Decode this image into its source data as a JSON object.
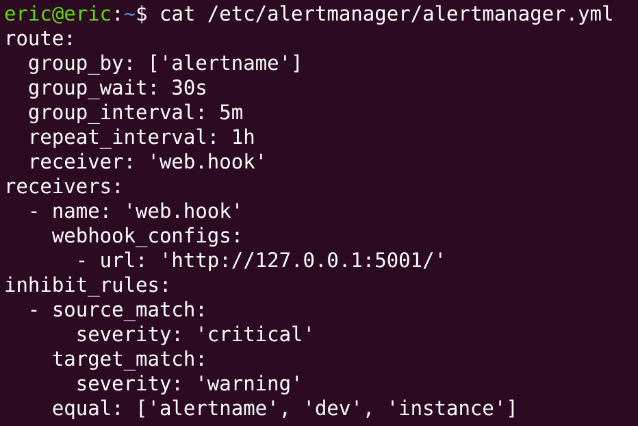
{
  "prompt": {
    "user_host": "eric@eric",
    "separator": ":",
    "cwd": "~",
    "symbol": "$ ",
    "command": "cat /etc/alertmanager/alertmanager.yml"
  },
  "colors": {
    "background": "#2c0a22",
    "text": "#ffffff",
    "user_host": "#5fd700",
    "cwd": "#5c8fd6"
  },
  "output_lines": [
    "route:",
    "  group_by: ['alertname']",
    "  group_wait: 30s",
    "  group_interval: 5m",
    "  repeat_interval: 1h",
    "  receiver: 'web.hook'",
    "receivers:",
    "  - name: 'web.hook'",
    "    webhook_configs:",
    "      - url: 'http://127.0.0.1:5001/'",
    "inhibit_rules:",
    "  - source_match:",
    "      severity: 'critical'",
    "    target_match:",
    "      severity: 'warning'",
    "    equal: ['alertname', 'dev', 'instance']"
  ]
}
